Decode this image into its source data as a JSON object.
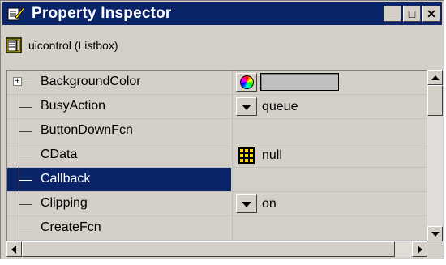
{
  "window": {
    "title": "Property Inspector",
    "minimize_glyph": "_",
    "maximize_glyph": "□",
    "close_glyph": "✕"
  },
  "object": {
    "label": "uicontrol (Listbox)"
  },
  "properties": [
    {
      "name": "BackgroundColor",
      "value": "",
      "editor": "color",
      "expandable": true
    },
    {
      "name": "BusyAction",
      "value": "queue",
      "editor": "dropdown"
    },
    {
      "name": "ButtonDownFcn",
      "value": "",
      "editor": "text"
    },
    {
      "name": "CData",
      "value": "null",
      "editor": "matrix"
    },
    {
      "name": "Callback",
      "value": "",
      "editor": "text",
      "selected": true
    },
    {
      "name": "Clipping",
      "value": "on",
      "editor": "dropdown"
    },
    {
      "name": "CreateFcn",
      "value": "",
      "editor": "text"
    }
  ],
  "colors": {
    "title_bar": "#0a246a",
    "selection": "#0a246a",
    "background_color_swatch": "#c0c0c0"
  }
}
